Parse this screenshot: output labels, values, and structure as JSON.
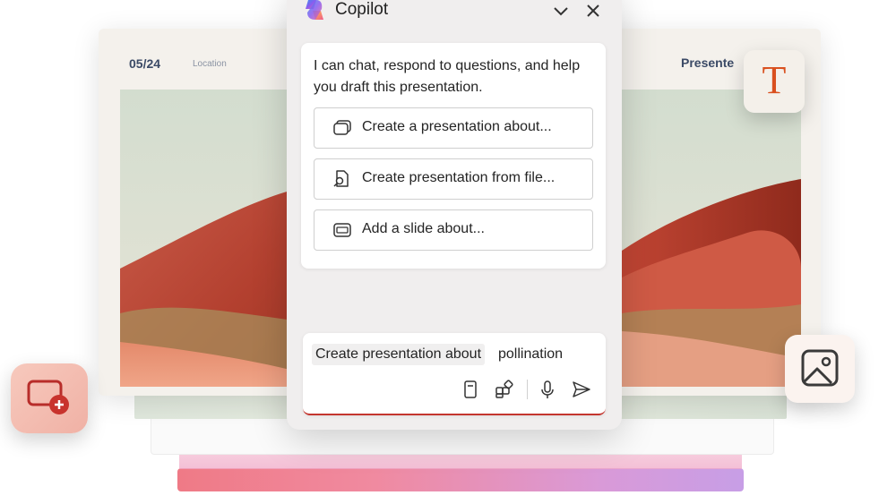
{
  "slide": {
    "date": "05/24",
    "location": "Location",
    "brand": "Presente"
  },
  "copilot": {
    "title": "Copilot",
    "logo_icon": "copilot-logo-icon",
    "message": "I can chat, respond to questions, and help you draft this presentation.",
    "suggestions": [
      {
        "label": "Create a presentation about...",
        "icon": "presentation-icon"
      },
      {
        "label": "Create presentation from file...",
        "icon": "file-search-icon"
      },
      {
        "label": "Add a slide about...",
        "icon": "slide-icon"
      }
    ],
    "input": {
      "chip": "Create presentation about",
      "value": "pollination"
    },
    "toolbar_icons": [
      "notebook-icon",
      "apps-icon",
      "microphone-icon",
      "send-icon"
    ]
  },
  "tiles": {
    "text_tile_glyph": "T"
  },
  "colors": {
    "accent_red": "#c4362f",
    "slide_text": "#3b4a66",
    "text_glyph": "#d9501f"
  }
}
